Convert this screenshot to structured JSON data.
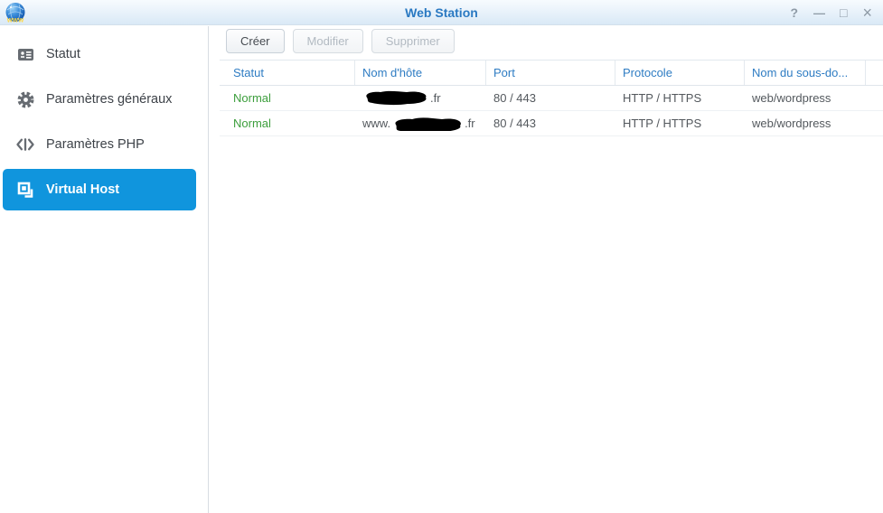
{
  "titlebar": {
    "title": "Web Station",
    "icons": {
      "help": "?",
      "minimize": "—",
      "maximize": "□",
      "close": "×"
    }
  },
  "sidebar": {
    "selected_color": "#1095dd",
    "items": [
      {
        "label": "Statut",
        "icon": "status-card-icon",
        "selected": false
      },
      {
        "label": "Paramètres généraux",
        "icon": "gear-icon",
        "selected": false
      },
      {
        "label": "Paramètres PHP",
        "icon": "code-brackets-icon",
        "selected": false
      },
      {
        "label": "Virtual Host",
        "icon": "virtual-host-icon",
        "selected": true
      }
    ]
  },
  "toolbar": {
    "create_label": "Créer",
    "modify_label": "Modifier",
    "delete_label": "Supprimer"
  },
  "table": {
    "header_color": "#2e7cc3",
    "status_color": "#3c9e3c",
    "columns": [
      "Statut",
      "Nom d'hôte",
      "Port",
      "Protocole",
      "Nom du sous-do..."
    ],
    "rows": [
      {
        "status": "Normal",
        "host_prefix": "",
        "host_redacted": "redacted",
        "host_suffix": ".fr",
        "port": "80 / 443",
        "protocol": "HTTP / HTTPS",
        "subfolder": "web/wordpress"
      },
      {
        "status": "Normal",
        "host_prefix": "www.",
        "host_redacted": "redacted",
        "host_suffix": ".fr",
        "port": "80 / 443",
        "protocol": "HTTP / HTTPS",
        "subfolder": "web/wordpress"
      }
    ]
  }
}
